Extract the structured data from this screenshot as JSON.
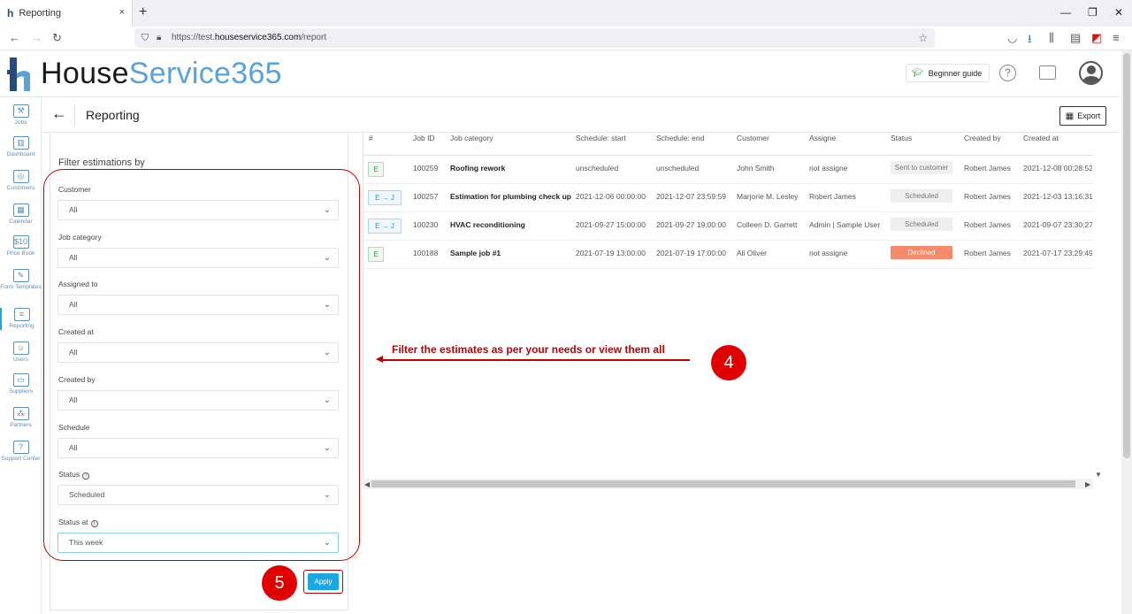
{
  "browser": {
    "tab_title": "Reporting",
    "tab_close": "×",
    "new_tab": "+",
    "url_prefix": "https://test.",
    "url_domain": "houseservice365.com",
    "url_path": "/report"
  },
  "app": {
    "logo_part1": "House",
    "logo_part2": "Service365",
    "beginner_guide": "Beginner guide",
    "help": "?"
  },
  "sidebar": {
    "items": [
      {
        "label": "Jobs",
        "icon": "tools-icon",
        "glyph": "⚒"
      },
      {
        "label": "Dashboard",
        "icon": "chart-icon",
        "glyph": "▥"
      },
      {
        "label": "Customers",
        "icon": "target-icon",
        "glyph": "◎"
      },
      {
        "label": "Calendar",
        "icon": "calendar-icon",
        "glyph": "▦"
      },
      {
        "label": "Price Book",
        "icon": "price-tag-icon",
        "glyph": "$10"
      },
      {
        "label": "Form Templates",
        "icon": "form-icon",
        "glyph": "✎"
      },
      {
        "label": "Reporting",
        "icon": "report-icon",
        "glyph": "≡"
      },
      {
        "label": "Users",
        "icon": "users-icon",
        "glyph": "☺"
      },
      {
        "label": "Suppliers",
        "icon": "truck-icon",
        "glyph": "▭"
      },
      {
        "label": "Partners",
        "icon": "network-icon",
        "glyph": "⁂"
      },
      {
        "label": "Support Center",
        "icon": "question-icon",
        "glyph": "?"
      }
    ]
  },
  "page": {
    "title": "Reporting",
    "export_label": "Export"
  },
  "filters": {
    "title": "Filter estimations by",
    "fields": [
      {
        "label": "Customer",
        "value": "All"
      },
      {
        "label": "Job category",
        "value": "All"
      },
      {
        "label": "Assigned to",
        "value": "All"
      },
      {
        "label": "Created at",
        "value": "All"
      },
      {
        "label": "Created by",
        "value": "All"
      },
      {
        "label": "Schedule",
        "value": "All"
      },
      {
        "label": "Status",
        "value": "Scheduled",
        "info": true
      },
      {
        "label": "Status at",
        "value": "This week",
        "info": true
      }
    ],
    "apply_label": "Apply"
  },
  "annotation": {
    "text": "Filter the estimates as per your needs or view them all",
    "step4": "4",
    "step5": "5"
  },
  "table": {
    "columns": [
      "#",
      "Job ID",
      "Job category",
      "Schedule: start",
      "Schedule: end",
      "Customer",
      "Assigne",
      "Status",
      "Created by",
      "Created at"
    ],
    "rows": [
      {
        "badge": "E",
        "job_id": "100259",
        "category": "Roofing rework",
        "start": "unscheduled",
        "end": "unscheduled",
        "customer": "John Smith",
        "assignee": "not assigne",
        "status": "Sent to customer",
        "created_by": "Robert James",
        "created_at": "2021-12-08 00:28:52"
      },
      {
        "badge": "E → J",
        "job_id": "100257",
        "category": "Estimation for plumbing check up",
        "start": "2021-12-06 00:00:00",
        "end": "2021-12-07 23:59:59",
        "customer": "Marjorie M. Lesley",
        "assignee": "Robert James",
        "status": "Scheduled",
        "created_by": "Robert James",
        "created_at": "2021-12-03 13:16:31"
      },
      {
        "badge": "E → J",
        "job_id": "100230",
        "category": "HVAC reconditioning",
        "start": "2021-09-27 15:00:00",
        "end": "2021-09-27 19:00:00",
        "customer": "Colleen D. Garrett",
        "assignee": "Admin | Sample User",
        "status": "Scheduled",
        "created_by": "Robert James",
        "created_at": "2021-09-07 23:30:27"
      },
      {
        "badge": "E",
        "job_id": "100188",
        "category": "Sample job #1",
        "start": "2021-07-19 13:00:00",
        "end": "2021-07-19 17:00:00",
        "customer": "Ali Oliver",
        "assignee": "not assigne",
        "status": "Declined",
        "created_by": "Robert James",
        "created_at": "2021-07-17 23:29:49"
      }
    ]
  },
  "colors": {
    "accent": "#19a8e0",
    "logo_blue": "#5aa2d8",
    "annotation_red": "#c00000",
    "declined": "#f58a6a"
  }
}
